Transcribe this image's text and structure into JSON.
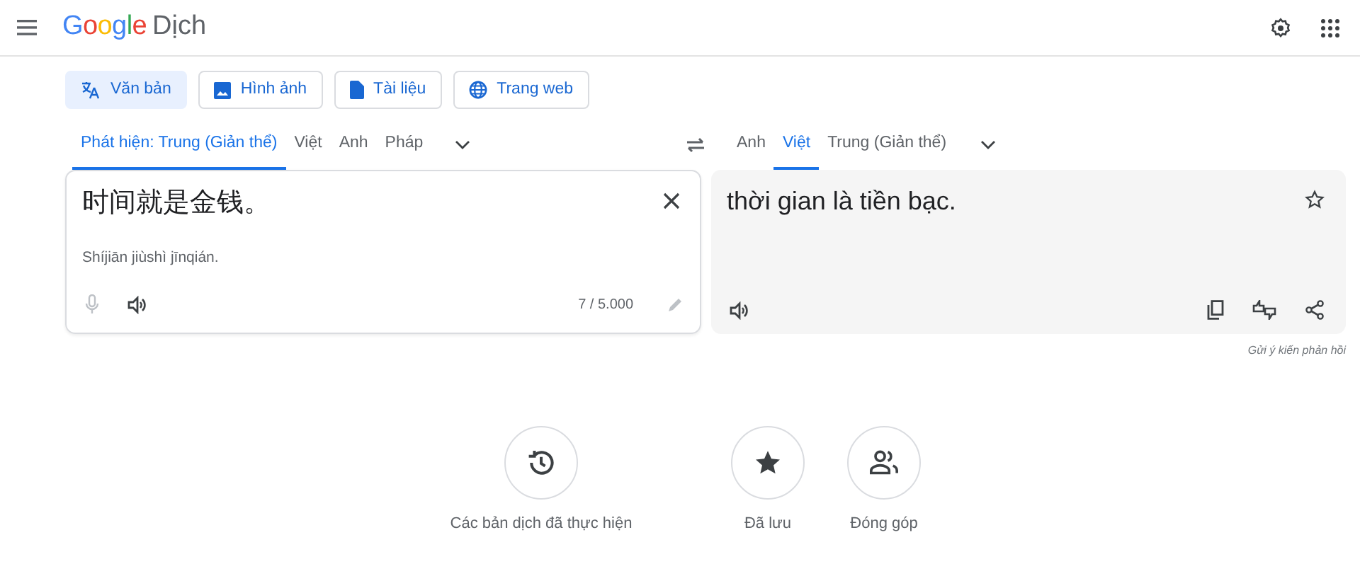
{
  "header": {
    "logo_word": "Google",
    "product": "Dịch"
  },
  "modes": [
    {
      "kind": "text",
      "label": "Văn bản",
      "selected": true
    },
    {
      "kind": "image",
      "label": "Hình ảnh",
      "selected": false
    },
    {
      "kind": "document",
      "label": "Tài liệu",
      "selected": false
    },
    {
      "kind": "website",
      "label": "Trang web",
      "selected": false
    }
  ],
  "source_languages": [
    {
      "label": "Phát hiện: Trung (Giản thể)",
      "selected": true
    },
    {
      "label": "Việt",
      "selected": false
    },
    {
      "label": "Anh",
      "selected": false
    },
    {
      "label": "Pháp",
      "selected": false
    }
  ],
  "target_languages": [
    {
      "label": "Anh",
      "selected": false
    },
    {
      "label": "Việt",
      "selected": true
    },
    {
      "label": "Trung (Giản thể)",
      "selected": false
    }
  ],
  "source": {
    "value": "时间就是金钱。",
    "romanization": "Shíjiān jiùshì jīnqián.",
    "char_count": "7 / 5.000"
  },
  "target": {
    "text": "thời gian là tiền bạc."
  },
  "feedback_link": "Gửi ý kiến phản hồi",
  "shortcuts": [
    {
      "kind": "history",
      "label": "Các bản dịch đã thực hiện"
    },
    {
      "kind": "saved",
      "label": "Đã lưu"
    },
    {
      "kind": "contribute",
      "label": "Đóng góp"
    }
  ]
}
